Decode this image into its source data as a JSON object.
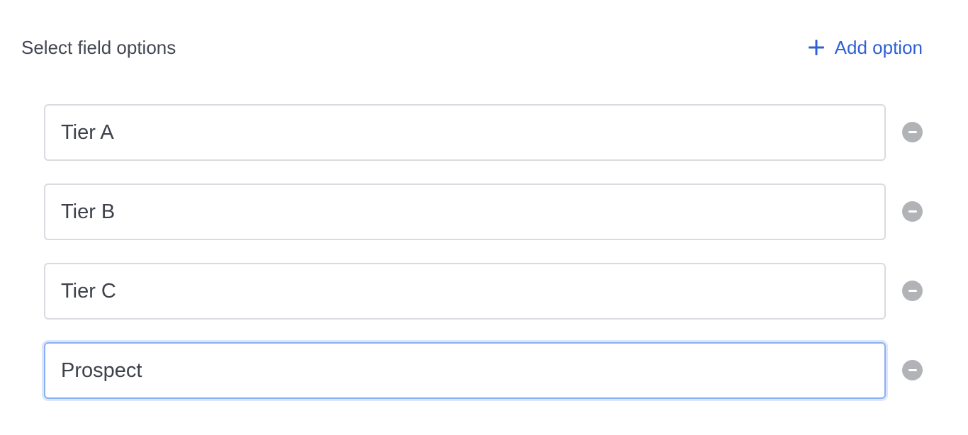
{
  "header": {
    "title": "Select field options",
    "add_label": "Add option",
    "add_icon": "plus-icon",
    "accent": "#2f61d5"
  },
  "options": [
    {
      "value": "Tier A",
      "focused": false
    },
    {
      "value": "Tier B",
      "focused": false
    },
    {
      "value": "Tier C",
      "focused": false
    },
    {
      "value": "Prospect",
      "focused": true
    }
  ],
  "remove_icon": "minus-circle-icon"
}
